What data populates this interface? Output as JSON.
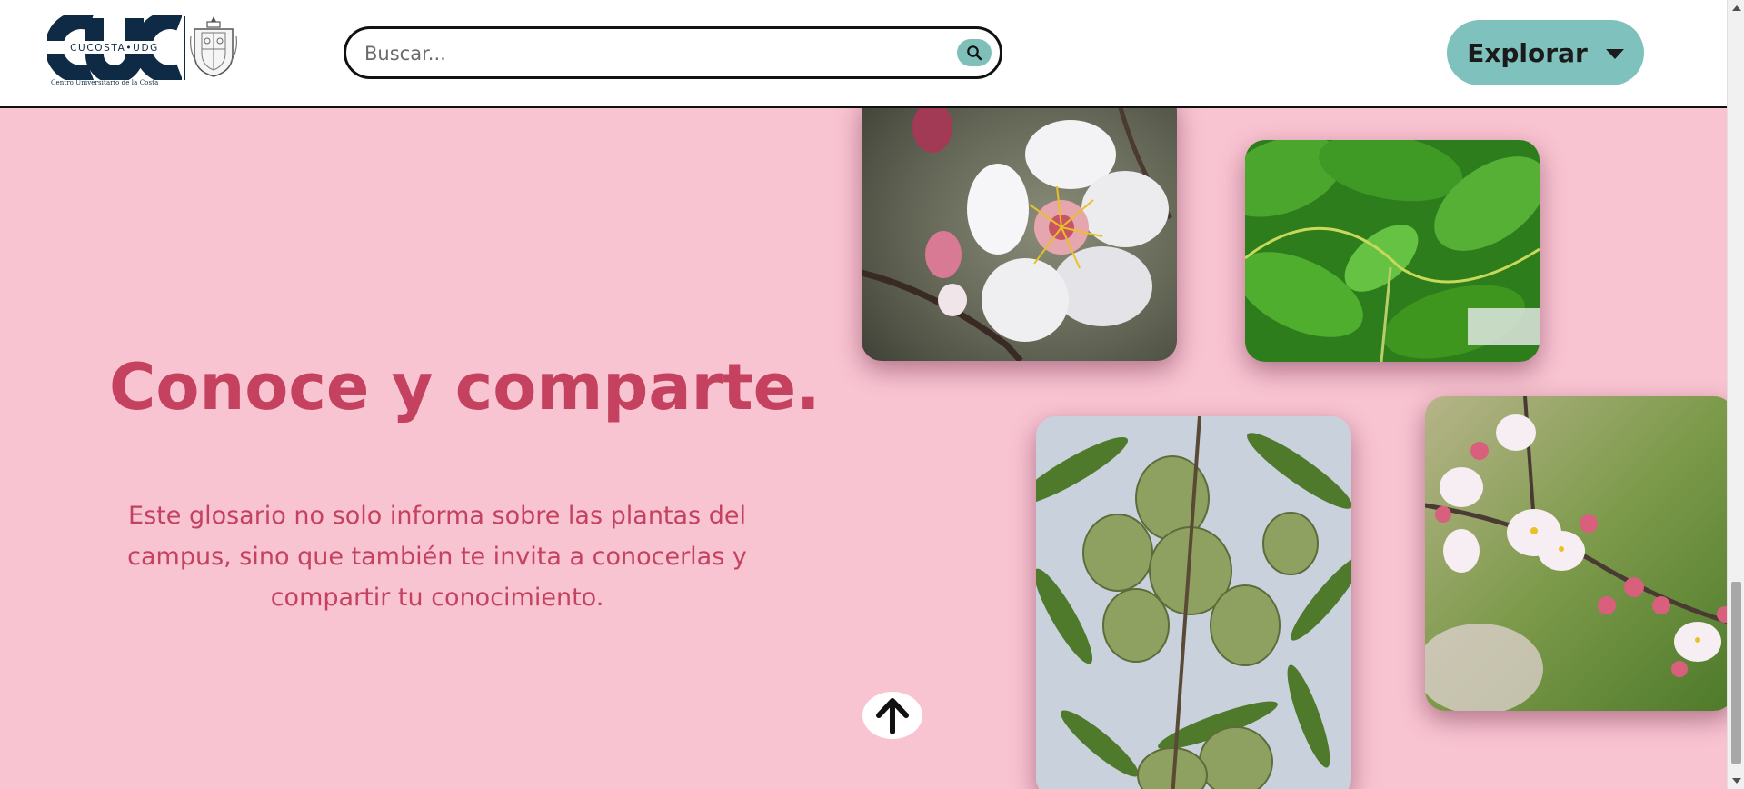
{
  "header": {
    "logo": {
      "text": "CUC",
      "tagline": "CUCOSTA•UDG",
      "caption": "Centro Universitario de la Costa",
      "icon": "university-shield-icon"
    },
    "search": {
      "placeholder": "Buscar...",
      "value": "",
      "icon": "search-icon"
    },
    "explore": {
      "label": "Explorar",
      "icon": "caret-down-icon"
    }
  },
  "hero": {
    "title": "Conoce y comparte.",
    "description": "Este glosario no solo informa sobre las plantas del campus, sino que también te invita a conocerlas y compartir tu conocimiento."
  },
  "gallery": [
    {
      "subject": "almond-blossom-photo"
    },
    {
      "subject": "green-leaves-photo"
    },
    {
      "subject": "green-almonds-photo"
    },
    {
      "subject": "pink-blossom-branch-photo"
    }
  ],
  "back_to_top": {
    "icon": "arrow-up-icon"
  },
  "colors": {
    "background": "#f9c4d2",
    "accent": "#c4425f",
    "button": "#7fc1bc",
    "header": "#ffffff"
  }
}
